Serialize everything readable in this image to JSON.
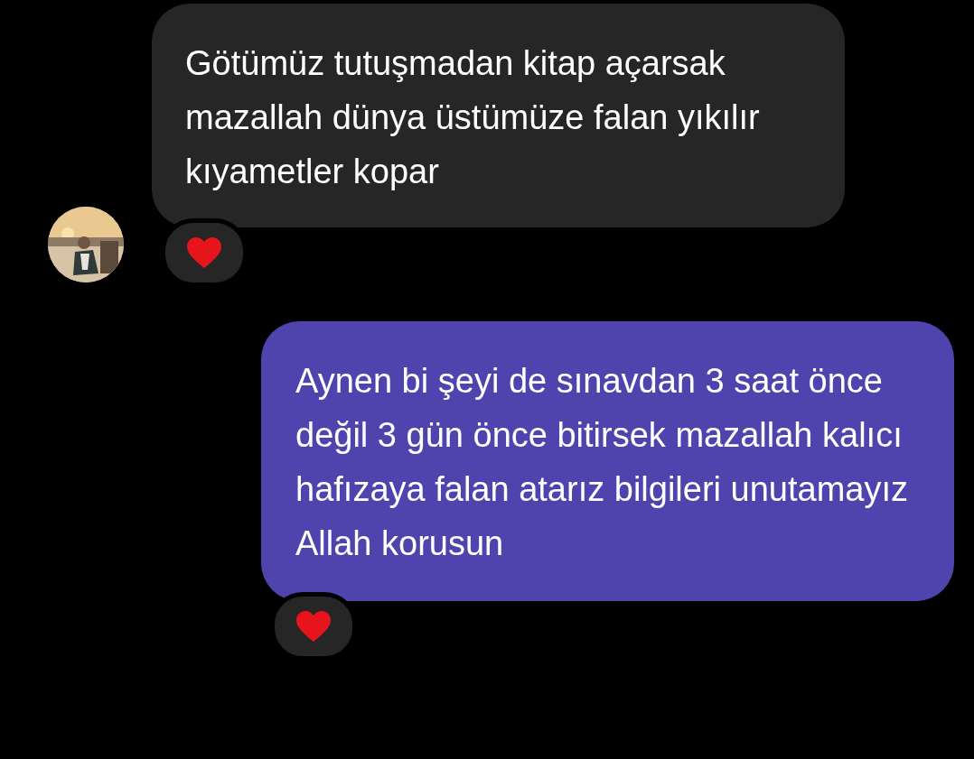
{
  "messages": [
    {
      "kind": "incoming",
      "text": "Götümüz tutuşmadan kitap açarsak mazallah dünya üstümüze falan yıkılır kıyametler kopar",
      "reacted": true
    },
    {
      "kind": "outgoing",
      "text": "Aynen bi şeyi de sınavdan 3 saat önce değil 3 gün önce bitirsek mazallah kalıcı hafızaya falan atarız bilgileri unutamayız Allah korusun",
      "reacted": true
    }
  ]
}
